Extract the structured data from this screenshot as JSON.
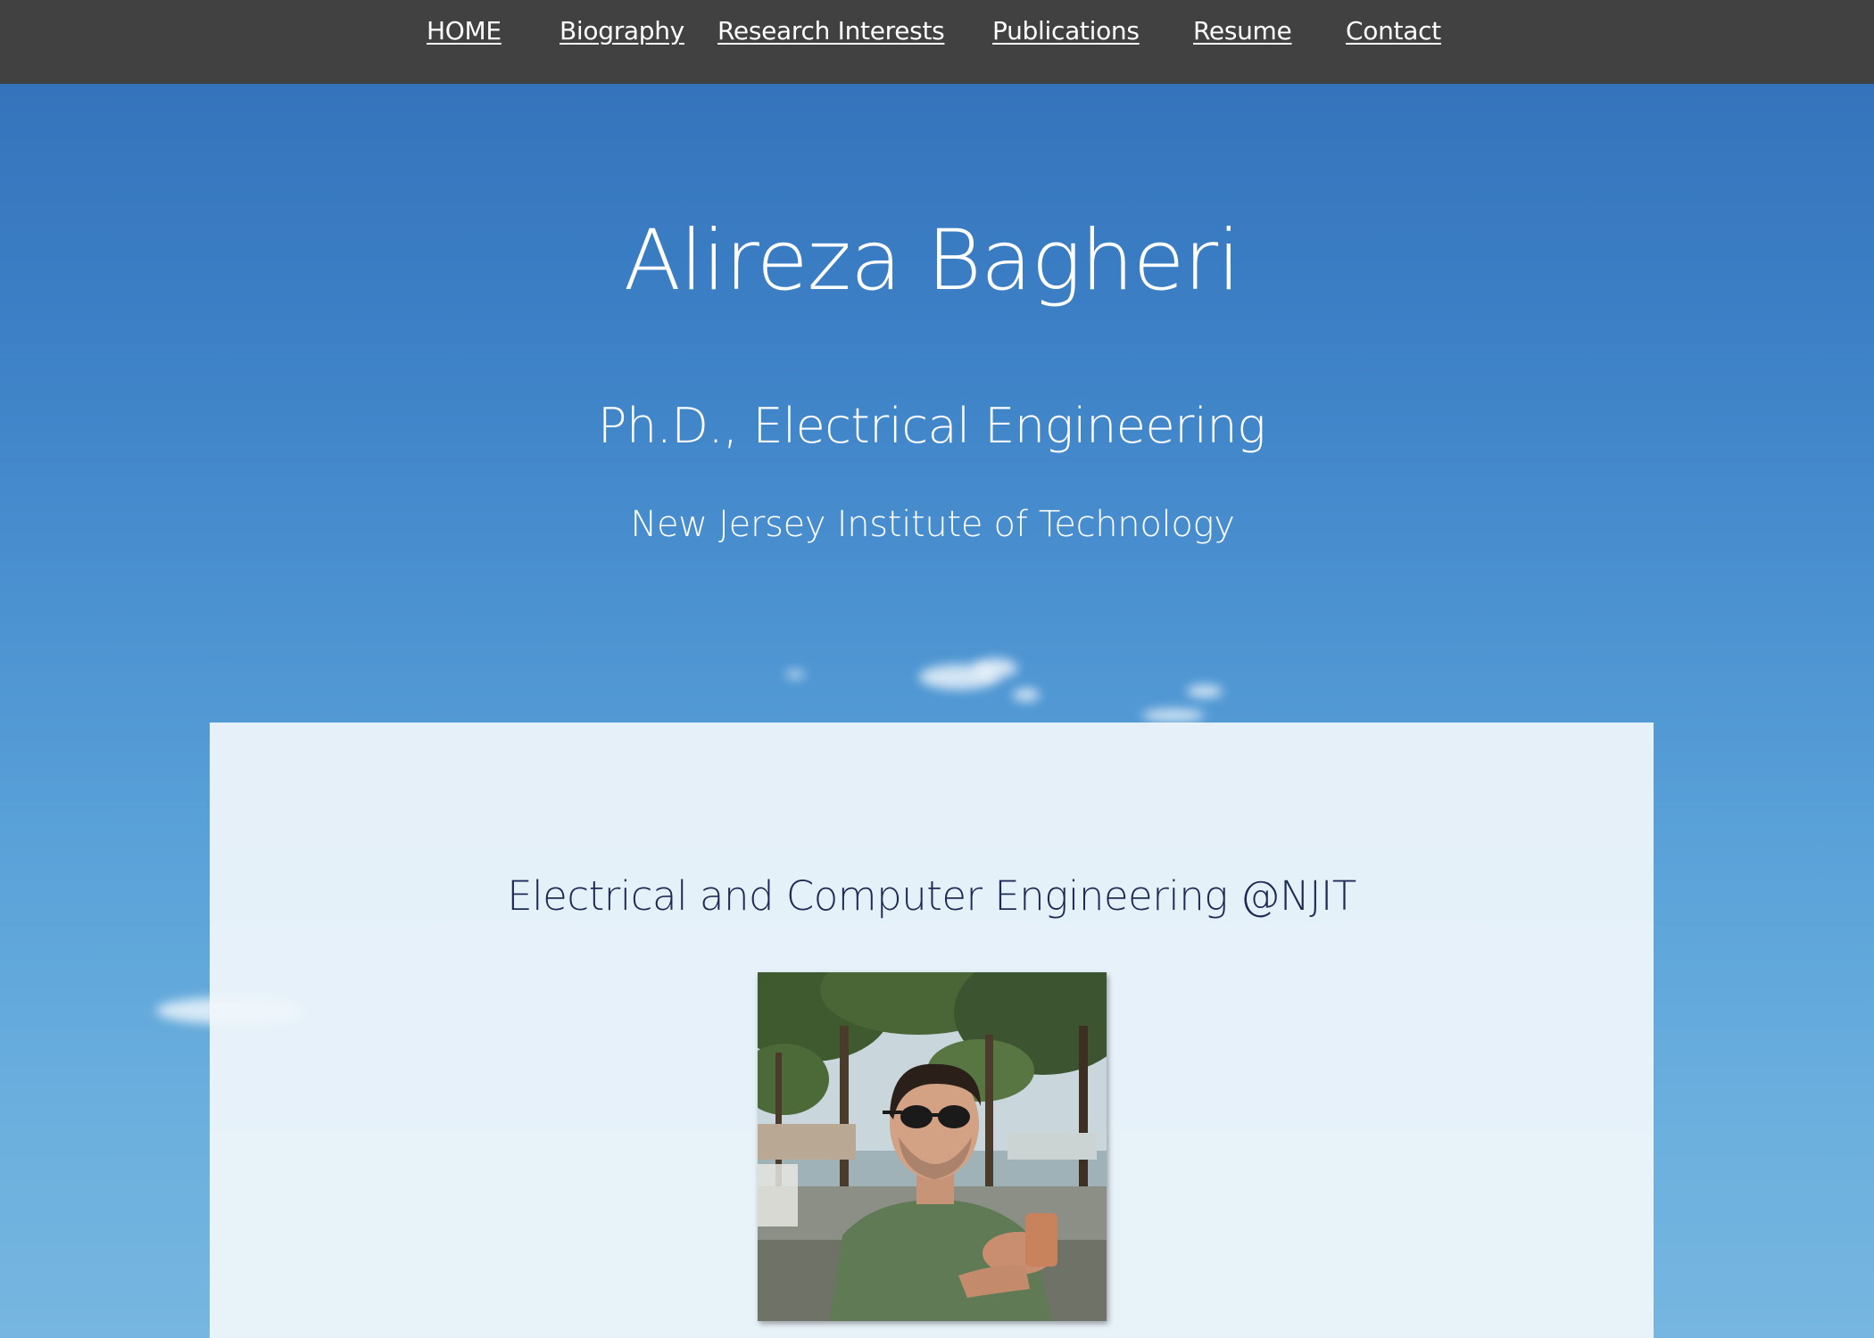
{
  "nav": {
    "items": [
      {
        "label": "HOME"
      },
      {
        "label": "Biography"
      },
      {
        "label": "Research Interests"
      },
      {
        "label": "Publications"
      },
      {
        "label": "Resume"
      },
      {
        "label": "Contact"
      }
    ]
  },
  "hero": {
    "name": "Alireza Bagheri",
    "degree": "Ph.D., Electrical Engineering",
    "school": "New Jersey Institute of Technology"
  },
  "card": {
    "heading": "Electrical and Computer Engineering @NJIT"
  },
  "colors": {
    "nav_background": "#414141",
    "sky_top": "#3270b8",
    "sky_bottom": "#76b6e0",
    "card_heading": "#1d2a55"
  }
}
